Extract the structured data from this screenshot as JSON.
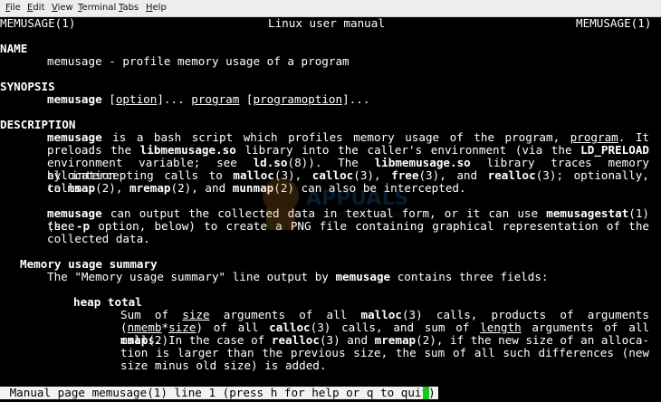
{
  "menu": {
    "file": {
      "key": "F",
      "rest": "ile"
    },
    "edit": {
      "key": "E",
      "rest": "dit"
    },
    "view": {
      "key": "V",
      "rest": "iew"
    },
    "terminal": {
      "key": "T",
      "rest": "erminal"
    },
    "tabs": {
      "key": "T",
      "rest": "abs"
    },
    "help": {
      "key": "H",
      "rest": "elp"
    }
  },
  "header": {
    "left": "MEMUSAGE(1)",
    "center": "Linux user manual",
    "right": "MEMUSAGE(1)"
  },
  "sections": {
    "name_heading": "NAME",
    "name_text": "memusage - profile memory usage of a program",
    "synopsis_heading": "SYNOPSIS",
    "synopsis_cmd": "memusage",
    "synopsis_option": "option",
    "synopsis_dots1": "]... ",
    "synopsis_program": "program",
    "synopsis_programoption": "programoption",
    "synopsis_dots2": "]...",
    "description_heading": "DESCRIPTION",
    "summary_heading": "Memory usage summary",
    "heap_total_heading": "heap total"
  },
  "status": {
    "text": " Manual page memusage(1) line 1 (press h for help or q to quit)"
  },
  "colors": {
    "background": "#000000",
    "text": "#ffffff",
    "cursor": "#19c919",
    "menubar": "#ededed"
  },
  "watermark": {
    "brand": "APPUALS",
    "tagline": "TECH HOW-TO'S FROM THE EXPERTS"
  }
}
